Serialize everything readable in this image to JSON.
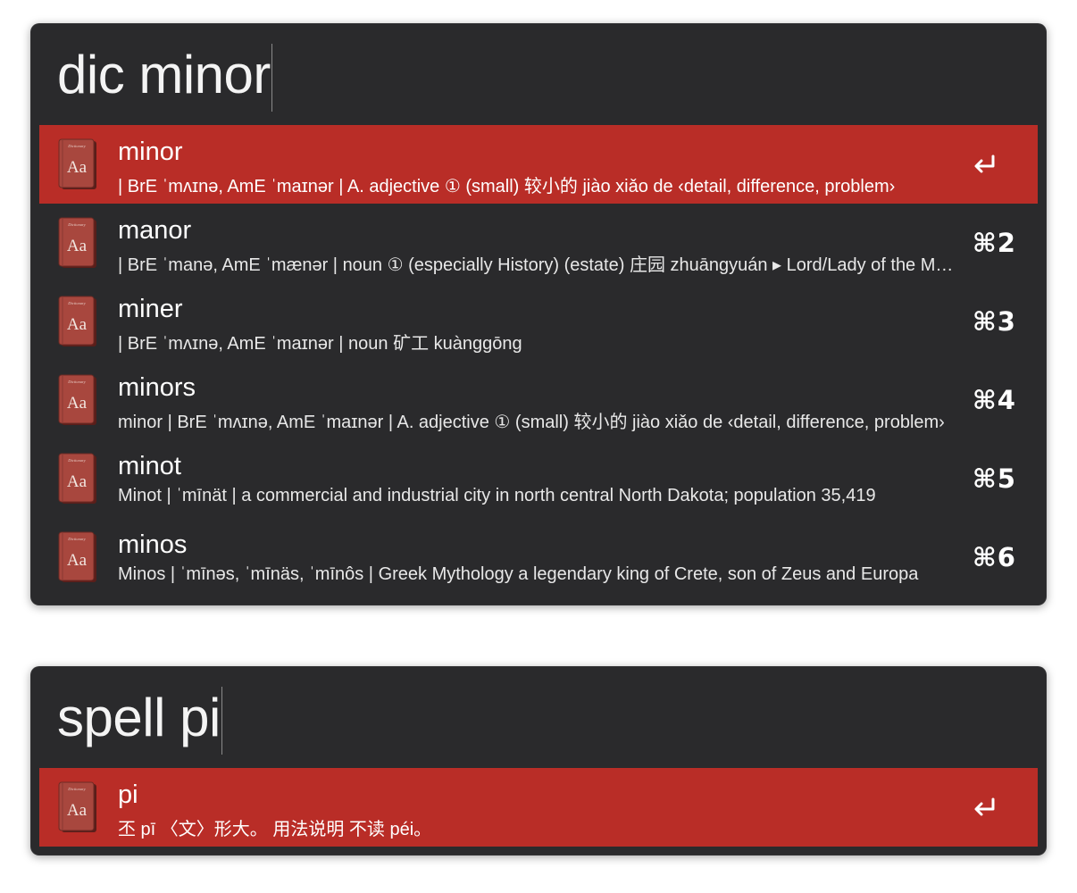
{
  "launcher1": {
    "query": "dic minor",
    "results": [
      {
        "title": "minor",
        "subtitle": "| BrE ˈmʌɪnə, AmE ˈmaɪnər | A. adjective ① (small) 较小的 jiào xiǎo de ‹detail, difference, problem›",
        "shortcut": "",
        "selected": true
      },
      {
        "title": "manor",
        "subtitle": "| BrE ˈmanə, AmE ˈmænər | noun ① (especially History) (estate) 庄园 zhuāngyuán ▸ Lord/Lady of the Manor",
        "shortcut": "⌘2",
        "selected": false
      },
      {
        "title": "miner",
        "subtitle": "| BrE ˈmʌɪnə, AmE ˈmaɪnər | noun 矿工 kuànggōng",
        "shortcut": "⌘3",
        "selected": false
      },
      {
        "title": "minors",
        "subtitle": "minor | BrE ˈmʌɪnə, AmE ˈmaɪnər | A. adjective ① (small) 较小的 jiào xiǎo de ‹detail, difference, problem›",
        "shortcut": "⌘4",
        "selected": false
      },
      {
        "title": "minot",
        "subtitle": "Minot | ˈmīnät | a commercial and industrial city in north central North Dakota; population 35,419",
        "shortcut": "⌘5",
        "selected": false
      },
      {
        "title": "minos",
        "subtitle": "Minos | ˈmīnəs, ˈmīnäs, ˈmīnôs | Greek Mythology a legendary king of Crete, son of Zeus and Europa",
        "shortcut": "⌘6",
        "selected": false
      }
    ]
  },
  "launcher2": {
    "query": "spell pi",
    "results": [
      {
        "title": "pi",
        "subtitle": "丕 pī 〈文〉形大。 用法说明 不读 péi。",
        "shortcut": "",
        "selected": true
      }
    ]
  },
  "icons": {
    "result_icon": "dictionary-icon",
    "action_icon": "return-key-icon",
    "dictionary_label": "Dictionary",
    "dictionary_glyph": "Aa"
  },
  "colors": {
    "window_bg": "#2a2a2c",
    "selected_row": "#b92d27",
    "text": "#ffffff"
  }
}
